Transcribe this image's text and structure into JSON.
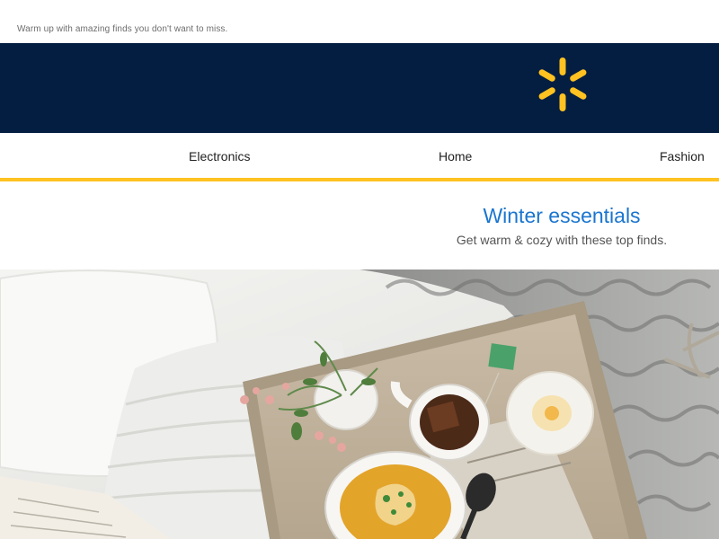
{
  "email": {
    "preheader": "Warm up with amazing finds you don't want to miss."
  },
  "brand": {
    "logo_icon": "spark-icon",
    "bar_color": "#041e42",
    "accent_color": "#ffc220"
  },
  "nav": {
    "items": [
      {
        "label": "Electronics"
      },
      {
        "label": "Home"
      },
      {
        "label": "Fashion"
      }
    ]
  },
  "hero": {
    "title": "Winter essentials",
    "subtitle": "Get warm & cozy with these top finds.",
    "title_color": "#1a75cf"
  }
}
